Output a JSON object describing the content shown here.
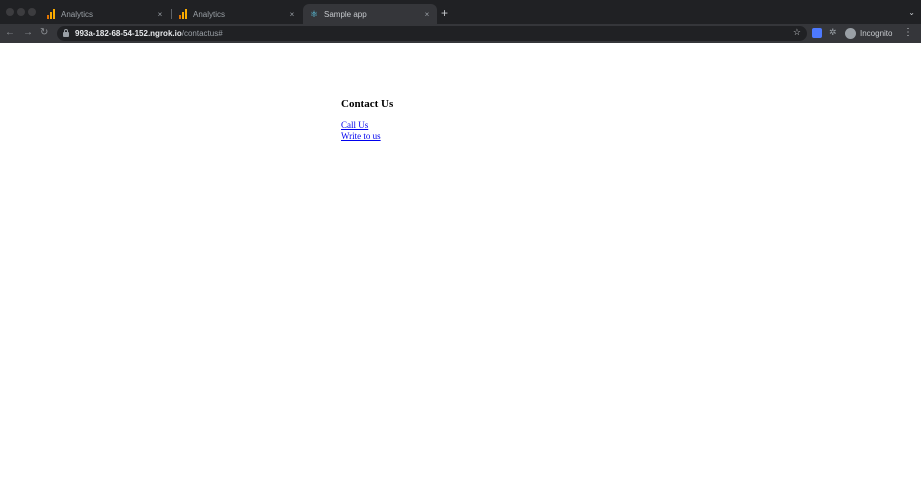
{
  "browser": {
    "tabs": [
      {
        "label": "Analytics",
        "icon": "analytics-icon",
        "close": "×"
      },
      {
        "label": "Analytics",
        "icon": "analytics-icon",
        "close": "×"
      },
      {
        "label": "Sample app",
        "icon": "react-icon",
        "close": "×"
      }
    ],
    "active_tab": 2,
    "new_tab": "+",
    "tab_menu": "⌄",
    "nav": {
      "back": "←",
      "forward": "→",
      "reload": "↻"
    },
    "url": {
      "host": "993a-182-68-54-152.ngrok.io",
      "path": "/contactus#"
    },
    "star": "☆",
    "extension_icon": "puzzle-icon",
    "profile_label": "Incognito",
    "menu": "⋮",
    "colors": {
      "chrome_dark": "#202124",
      "chrome_toolbar": "#35363a",
      "link": "#0000ee"
    }
  },
  "page": {
    "heading": "Contact Us",
    "links": [
      "Call Us",
      "Write to us"
    ]
  }
}
